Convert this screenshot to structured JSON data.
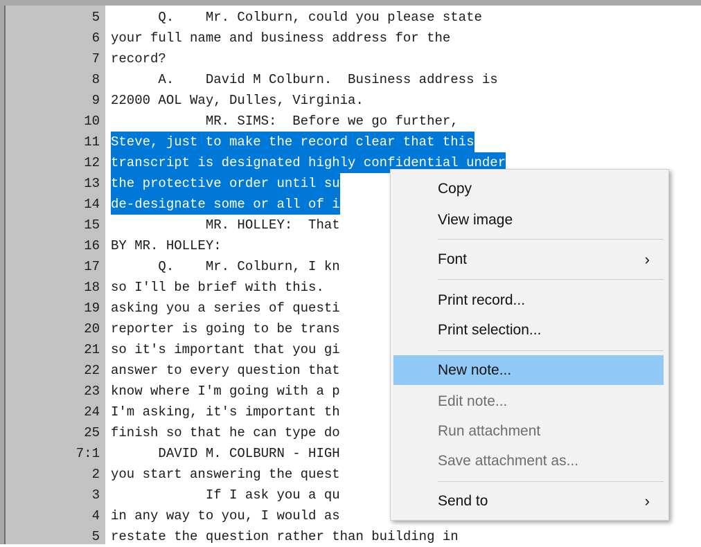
{
  "gutter": {
    "line_numbers": [
      "5",
      "6",
      "7",
      "8",
      "9",
      "10",
      "11",
      "12",
      "13",
      "14",
      "15",
      "16",
      "17",
      "18",
      "19",
      "20",
      "21",
      "22",
      "23",
      "24",
      "25",
      "7:1",
      "2",
      "3",
      "4",
      "5"
    ]
  },
  "transcript": {
    "lines": [
      "      Q.    Mr. Colburn, could you please state",
      "your full name and business address for the",
      "record?",
      "      A.    David M Colburn.  Business address is",
      "22000 AOL Way, Dulles, Virginia.",
      "            MR. SIMS:  Before we go further,",
      "Steve, just to make the record clear that this",
      "transcript is designated highly confidential under",
      "the protective order until su",
      "de-designate some or all of i",
      "            MR. HOLLEY:  That",
      "BY MR. HOLLEY:",
      "      Q.    Mr. Colburn, I kn",
      "so I'll be brief with this.",
      "asking you a series of questi",
      "reporter is going to be trans",
      "so it's important that you gi",
      "answer to every question that",
      "know where I'm going with a p",
      "I'm asking, it's important th",
      "finish so that he can type do",
      "      DAVID M. COLBURN - HIGH",
      "you start answering the quest",
      "            If I ask you a qu",
      "in any way to you, I would as",
      "restate the question rather than building in"
    ],
    "selected_line_indices": [
      6,
      7,
      8,
      9
    ]
  },
  "context_menu": {
    "items": [
      {
        "label": "Copy",
        "state": "enabled"
      },
      {
        "label": "View image",
        "state": "enabled"
      },
      {
        "label": "Font",
        "state": "enabled",
        "submenu": true
      },
      {
        "label": "Print record...",
        "state": "enabled"
      },
      {
        "label": "Print selection...",
        "state": "enabled"
      },
      {
        "label": "New note...",
        "state": "highlighted"
      },
      {
        "label": "Edit note...",
        "state": "disabled"
      },
      {
        "label": "Run attachment",
        "state": "disabled"
      },
      {
        "label": "Save attachment as...",
        "state": "disabled"
      },
      {
        "label": "Send to",
        "state": "enabled",
        "submenu": true
      }
    ],
    "submenu_arrow_glyph": "›"
  },
  "colors": {
    "selection": "#0078d7",
    "menu_highlight": "#91c9f7",
    "gutter": "#c2c2c2",
    "menu_background": "#f2f2f2",
    "disabled_text": "#6d6d6d"
  }
}
